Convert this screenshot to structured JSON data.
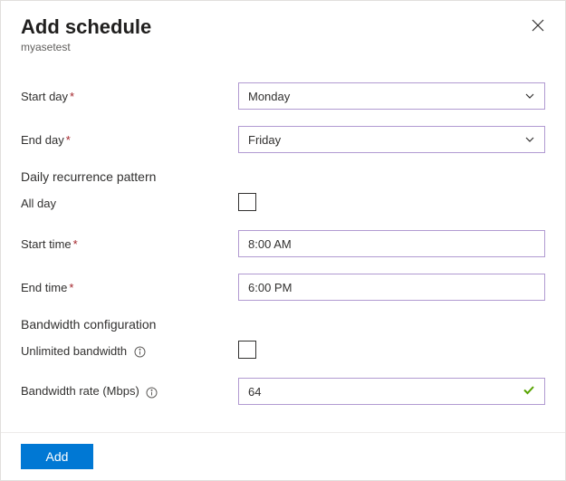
{
  "header": {
    "title": "Add schedule",
    "subtitle": "myasetest"
  },
  "form": {
    "start_day": {
      "label": "Start day",
      "value": "Monday"
    },
    "end_day": {
      "label": "End day",
      "value": "Friday"
    },
    "recurrence_section": "Daily recurrence pattern",
    "all_day": {
      "label": "All day",
      "checked": false
    },
    "start_time": {
      "label": "Start time",
      "value": "8:00 AM"
    },
    "end_time": {
      "label": "End time",
      "value": "6:00 PM"
    },
    "bandwidth_section": "Bandwidth configuration",
    "unlimited_bandwidth": {
      "label": "Unlimited bandwidth",
      "checked": false
    },
    "bandwidth_rate": {
      "label": "Bandwidth rate (Mbps)",
      "value": "64"
    }
  },
  "footer": {
    "add_label": "Add"
  }
}
